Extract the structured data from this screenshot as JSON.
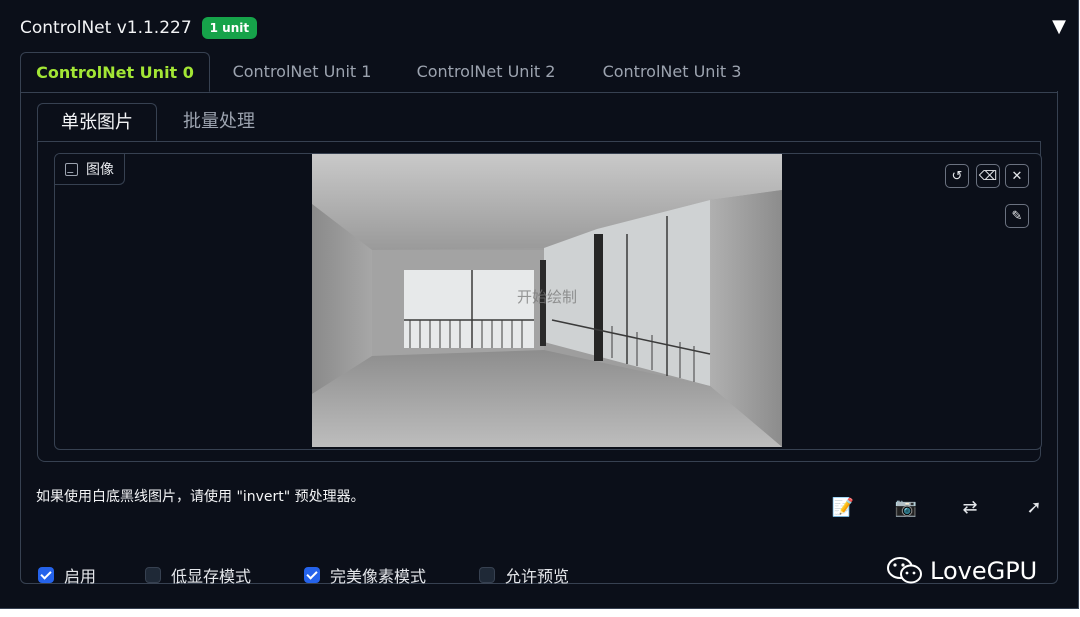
{
  "header": {
    "title": "ControlNet v1.1.227",
    "badge": "1 unit",
    "collapse_icon": "▼"
  },
  "unit_tabs": [
    {
      "label": "ControlNet Unit 0",
      "active": true
    },
    {
      "label": "ControlNet Unit 1",
      "active": false
    },
    {
      "label": "ControlNet Unit 2",
      "active": false
    },
    {
      "label": "ControlNet Unit 3",
      "active": false
    }
  ],
  "sub_tabs": [
    {
      "label": "单张图片",
      "active": true
    },
    {
      "label": "批量处理",
      "active": false
    }
  ],
  "image": {
    "label": "图像",
    "overlay_text": "开始绘制",
    "tools": [
      "undo-icon",
      "eraser-icon",
      "close-icon",
      "brush-icon"
    ]
  },
  "hint": "如果使用白底黑线图片，请使用 \"invert\" 预处理器。",
  "actions": [
    "edit-icon",
    "camera-icon",
    "swap-icon",
    "send-arrow-icon"
  ],
  "checkboxes": [
    {
      "label": "启用",
      "checked": true
    },
    {
      "label": "低显存模式",
      "checked": false
    },
    {
      "label": "完美像素模式",
      "checked": true
    },
    {
      "label": "允许预览",
      "checked": false
    }
  ],
  "watermark": {
    "text": "LoveGPU"
  },
  "colors": {
    "accent": "#a3e635",
    "badge": "#16a34a",
    "checkbox": "#2563eb",
    "background": "#0b0f19"
  }
}
